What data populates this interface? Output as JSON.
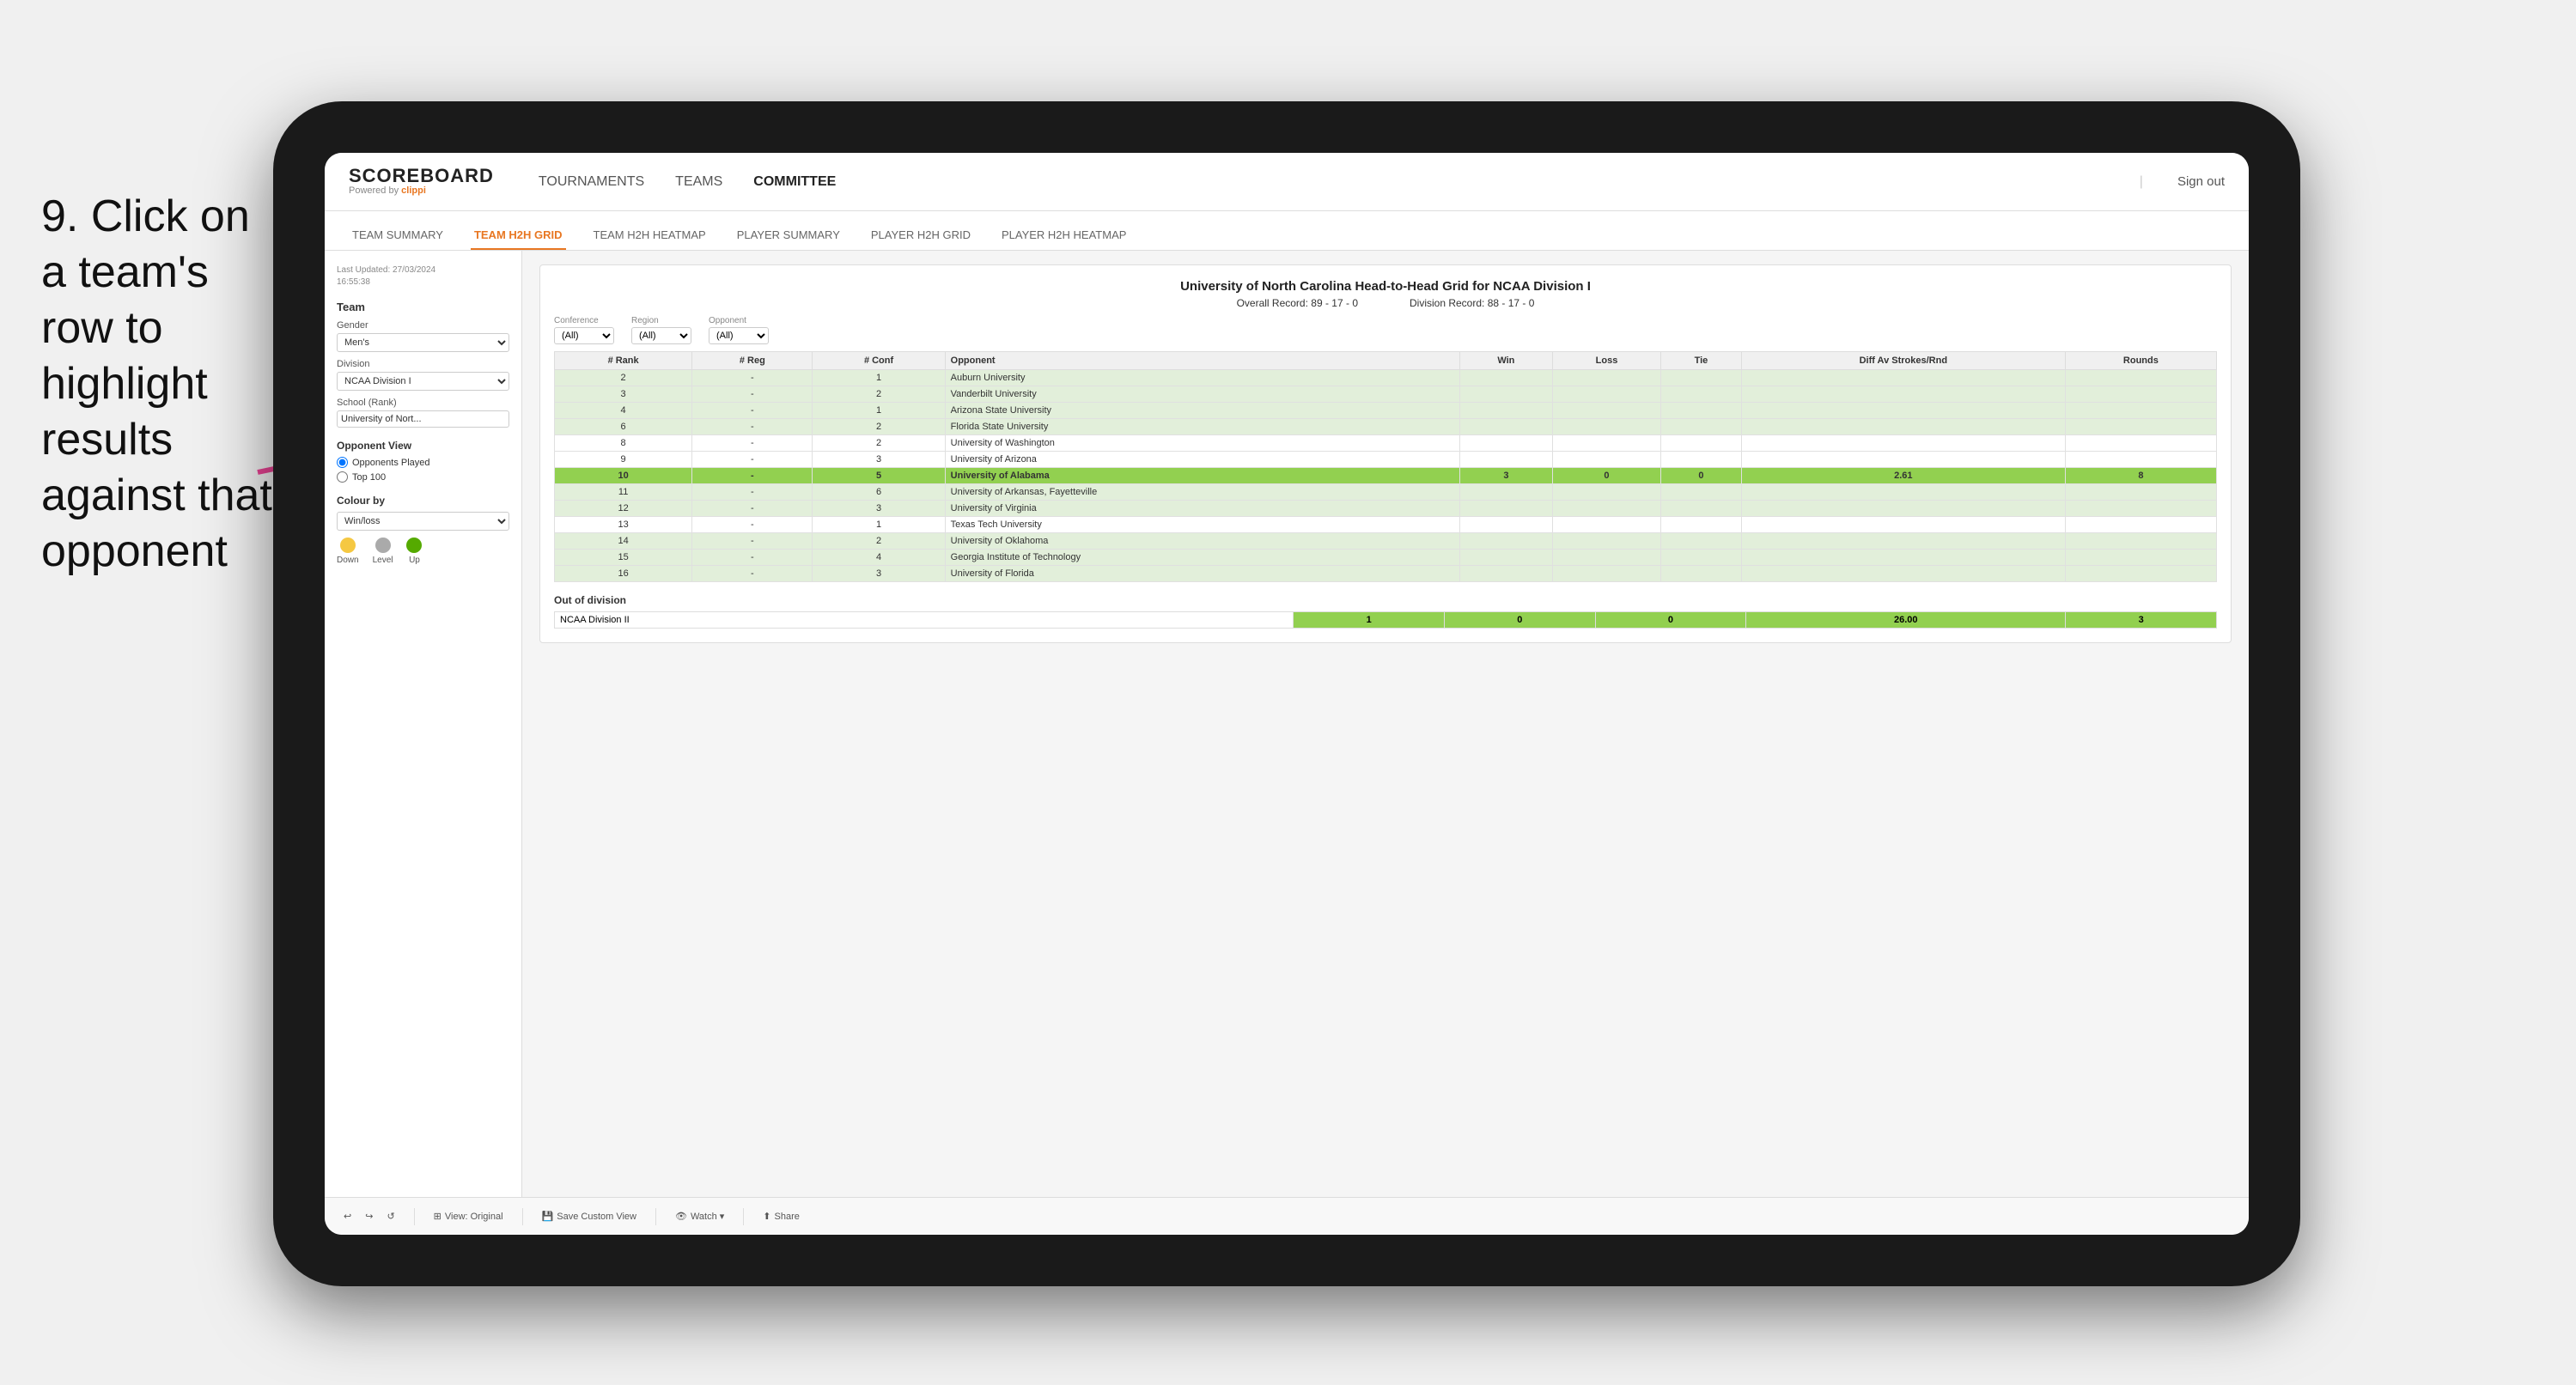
{
  "instruction": {
    "text": "9. Click on a team's row to highlight results against that opponent"
  },
  "nav": {
    "logo": "SCOREBOARD",
    "powered_by": "Powered by clippi",
    "links": [
      "TOURNAMENTS",
      "TEAMS",
      "COMMITTEE"
    ],
    "sign_out": "Sign out"
  },
  "sub_tabs": [
    {
      "label": "TEAM SUMMARY",
      "active": false
    },
    {
      "label": "TEAM H2H GRID",
      "active": true
    },
    {
      "label": "TEAM H2H HEATMAP",
      "active": false
    },
    {
      "label": "PLAYER SUMMARY",
      "active": false
    },
    {
      "label": "PLAYER H2H GRID",
      "active": false
    },
    {
      "label": "PLAYER H2H HEATMAP",
      "active": false
    }
  ],
  "sidebar": {
    "last_updated": "Last Updated: 27/03/2024\n16:55:38",
    "team_label": "Team",
    "gender_label": "Gender",
    "gender_value": "Men's",
    "division_label": "Division",
    "division_value": "NCAA Division I",
    "school_label": "School (Rank)",
    "school_value": "University of Nort...",
    "opponent_view_label": "Opponent View",
    "opponent_view_options": [
      "Opponents Played",
      "Top 100"
    ],
    "colour_by_label": "Colour by",
    "colour_by_value": "Win/loss",
    "legend": [
      {
        "color": "#f5c842",
        "label": "Down"
      },
      {
        "color": "#aaaaaa",
        "label": "Level"
      },
      {
        "color": "#55aa00",
        "label": "Up"
      }
    ]
  },
  "grid": {
    "title": "University of North Carolina Head-to-Head Grid for NCAA Division I",
    "overall_record_label": "Overall Record:",
    "overall_record": "89 - 17 - 0",
    "division_record_label": "Division Record:",
    "division_record": "88 - 17 - 0",
    "filters": {
      "conference_label": "Conference",
      "conference_value": "(All)",
      "region_label": "Region",
      "region_value": "(All)",
      "opponent_label": "Opponent",
      "opponent_value": "(All)"
    },
    "table_headers": [
      {
        "key": "rank",
        "label": "# Rank"
      },
      {
        "key": "reg",
        "label": "# Reg"
      },
      {
        "key": "conf",
        "label": "# Conf"
      },
      {
        "key": "opponent",
        "label": "Opponent"
      },
      {
        "key": "win",
        "label": "Win"
      },
      {
        "key": "loss",
        "label": "Loss"
      },
      {
        "key": "tie",
        "label": "Tie"
      },
      {
        "key": "diff_av",
        "label": "Diff Av Strokes/Rnd"
      },
      {
        "key": "rounds",
        "label": "Rounds"
      }
    ],
    "rows": [
      {
        "rank": "2",
        "reg": "-",
        "conf": "1",
        "opponent": "Auburn University",
        "win": "",
        "loss": "",
        "tie": "",
        "diff": "",
        "rounds": "",
        "color": "green-light"
      },
      {
        "rank": "3",
        "reg": "-",
        "conf": "2",
        "opponent": "Vanderbilt University",
        "win": "",
        "loss": "",
        "tie": "",
        "diff": "",
        "rounds": "",
        "color": "green-light"
      },
      {
        "rank": "4",
        "reg": "-",
        "conf": "1",
        "opponent": "Arizona State University",
        "win": "",
        "loss": "",
        "tie": "",
        "diff": "",
        "rounds": "",
        "color": "green-light"
      },
      {
        "rank": "6",
        "reg": "-",
        "conf": "2",
        "opponent": "Florida State University",
        "win": "",
        "loss": "",
        "tie": "",
        "diff": "",
        "rounds": "",
        "color": "green-light"
      },
      {
        "rank": "8",
        "reg": "-",
        "conf": "2",
        "opponent": "University of Washington",
        "win": "",
        "loss": "",
        "tie": "",
        "diff": "",
        "rounds": "",
        "color": "neutral"
      },
      {
        "rank": "9",
        "reg": "-",
        "conf": "3",
        "opponent": "University of Arizona",
        "win": "",
        "loss": "",
        "tie": "",
        "diff": "",
        "rounds": "",
        "color": "neutral"
      },
      {
        "rank": "10",
        "reg": "-",
        "conf": "5",
        "opponent": "University of Alabama",
        "win": "3",
        "loss": "0",
        "tie": "0",
        "diff": "2.61",
        "rounds": "8",
        "color": "highlighted"
      },
      {
        "rank": "11",
        "reg": "-",
        "conf": "6",
        "opponent": "University of Arkansas, Fayetteville",
        "win": "",
        "loss": "",
        "tie": "",
        "diff": "",
        "rounds": "",
        "color": "green-light"
      },
      {
        "rank": "12",
        "reg": "-",
        "conf": "3",
        "opponent": "University of Virginia",
        "win": "",
        "loss": "",
        "tie": "",
        "diff": "",
        "rounds": "",
        "color": "green-light"
      },
      {
        "rank": "13",
        "reg": "-",
        "conf": "1",
        "opponent": "Texas Tech University",
        "win": "",
        "loss": "",
        "tie": "",
        "diff": "",
        "rounds": "",
        "color": "neutral"
      },
      {
        "rank": "14",
        "reg": "-",
        "conf": "2",
        "opponent": "University of Oklahoma",
        "win": "",
        "loss": "",
        "tie": "",
        "diff": "",
        "rounds": "",
        "color": "green-light"
      },
      {
        "rank": "15",
        "reg": "-",
        "conf": "4",
        "opponent": "Georgia Institute of Technology",
        "win": "",
        "loss": "",
        "tie": "",
        "diff": "",
        "rounds": "",
        "color": "green-light"
      },
      {
        "rank": "16",
        "reg": "-",
        "conf": "3",
        "opponent": "University of Florida",
        "win": "",
        "loss": "",
        "tie": "",
        "diff": "",
        "rounds": "",
        "color": "green-light"
      }
    ],
    "out_of_division_label": "Out of division",
    "out_of_division_rows": [
      {
        "division": "NCAA Division II",
        "win": "1",
        "loss": "0",
        "tie": "0",
        "diff": "26.00",
        "rounds": "3",
        "color": "green"
      }
    ]
  },
  "toolbar": {
    "buttons": [
      "View: Original",
      "Save Custom View",
      "Watch ▾",
      "Share"
    ]
  }
}
